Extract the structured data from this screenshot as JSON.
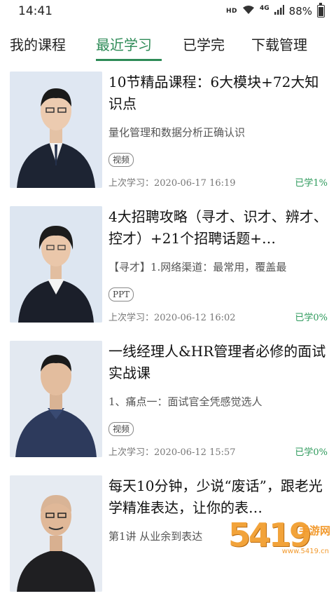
{
  "status": {
    "time": "14:41",
    "network_label": "HD",
    "signal_label": "4G",
    "battery": "88%"
  },
  "tabs": [
    {
      "label": "我的课程",
      "active": false
    },
    {
      "label": "最近学习",
      "active": true
    },
    {
      "label": "已学完",
      "active": false
    },
    {
      "label": "下载管理",
      "active": false
    }
  ],
  "courses": [
    {
      "title": "10节精品课程：6大模块+72大知识点",
      "desc": "量化管理和数据分析正确认识",
      "badge": "视频",
      "last_study": "上次学习：2020-06-17  16:19",
      "progress": "已学1%"
    },
    {
      "title": "4大招聘攻略（寻才、识才、辨才、控才）+21个招聘话题+…",
      "desc": "【寻才】1.网络渠道：最常用，覆盖最",
      "badge": "PPT",
      "last_study": "上次学习：2020-06-12  16:02",
      "progress": "已学0%"
    },
    {
      "title": "一线经理人&HR管理者必修的面试实战课",
      "desc": "1、痛点一：面试官全凭感觉选人",
      "badge": "视频",
      "last_study": "上次学习：2020-06-12  15:57",
      "progress": "已学0%"
    },
    {
      "title": "每天10分钟，少说“废话”，跟老光学精准表达，让你的表…",
      "desc": "第1讲  从业余到表达",
      "badge": "",
      "last_study": "",
      "progress": ""
    }
  ],
  "watermark": {
    "number": "5419",
    "text": "手游网",
    "url": "www.5419.cn"
  },
  "colors": {
    "accent": "#2e8b57",
    "progress": "#2e9a5c"
  }
}
